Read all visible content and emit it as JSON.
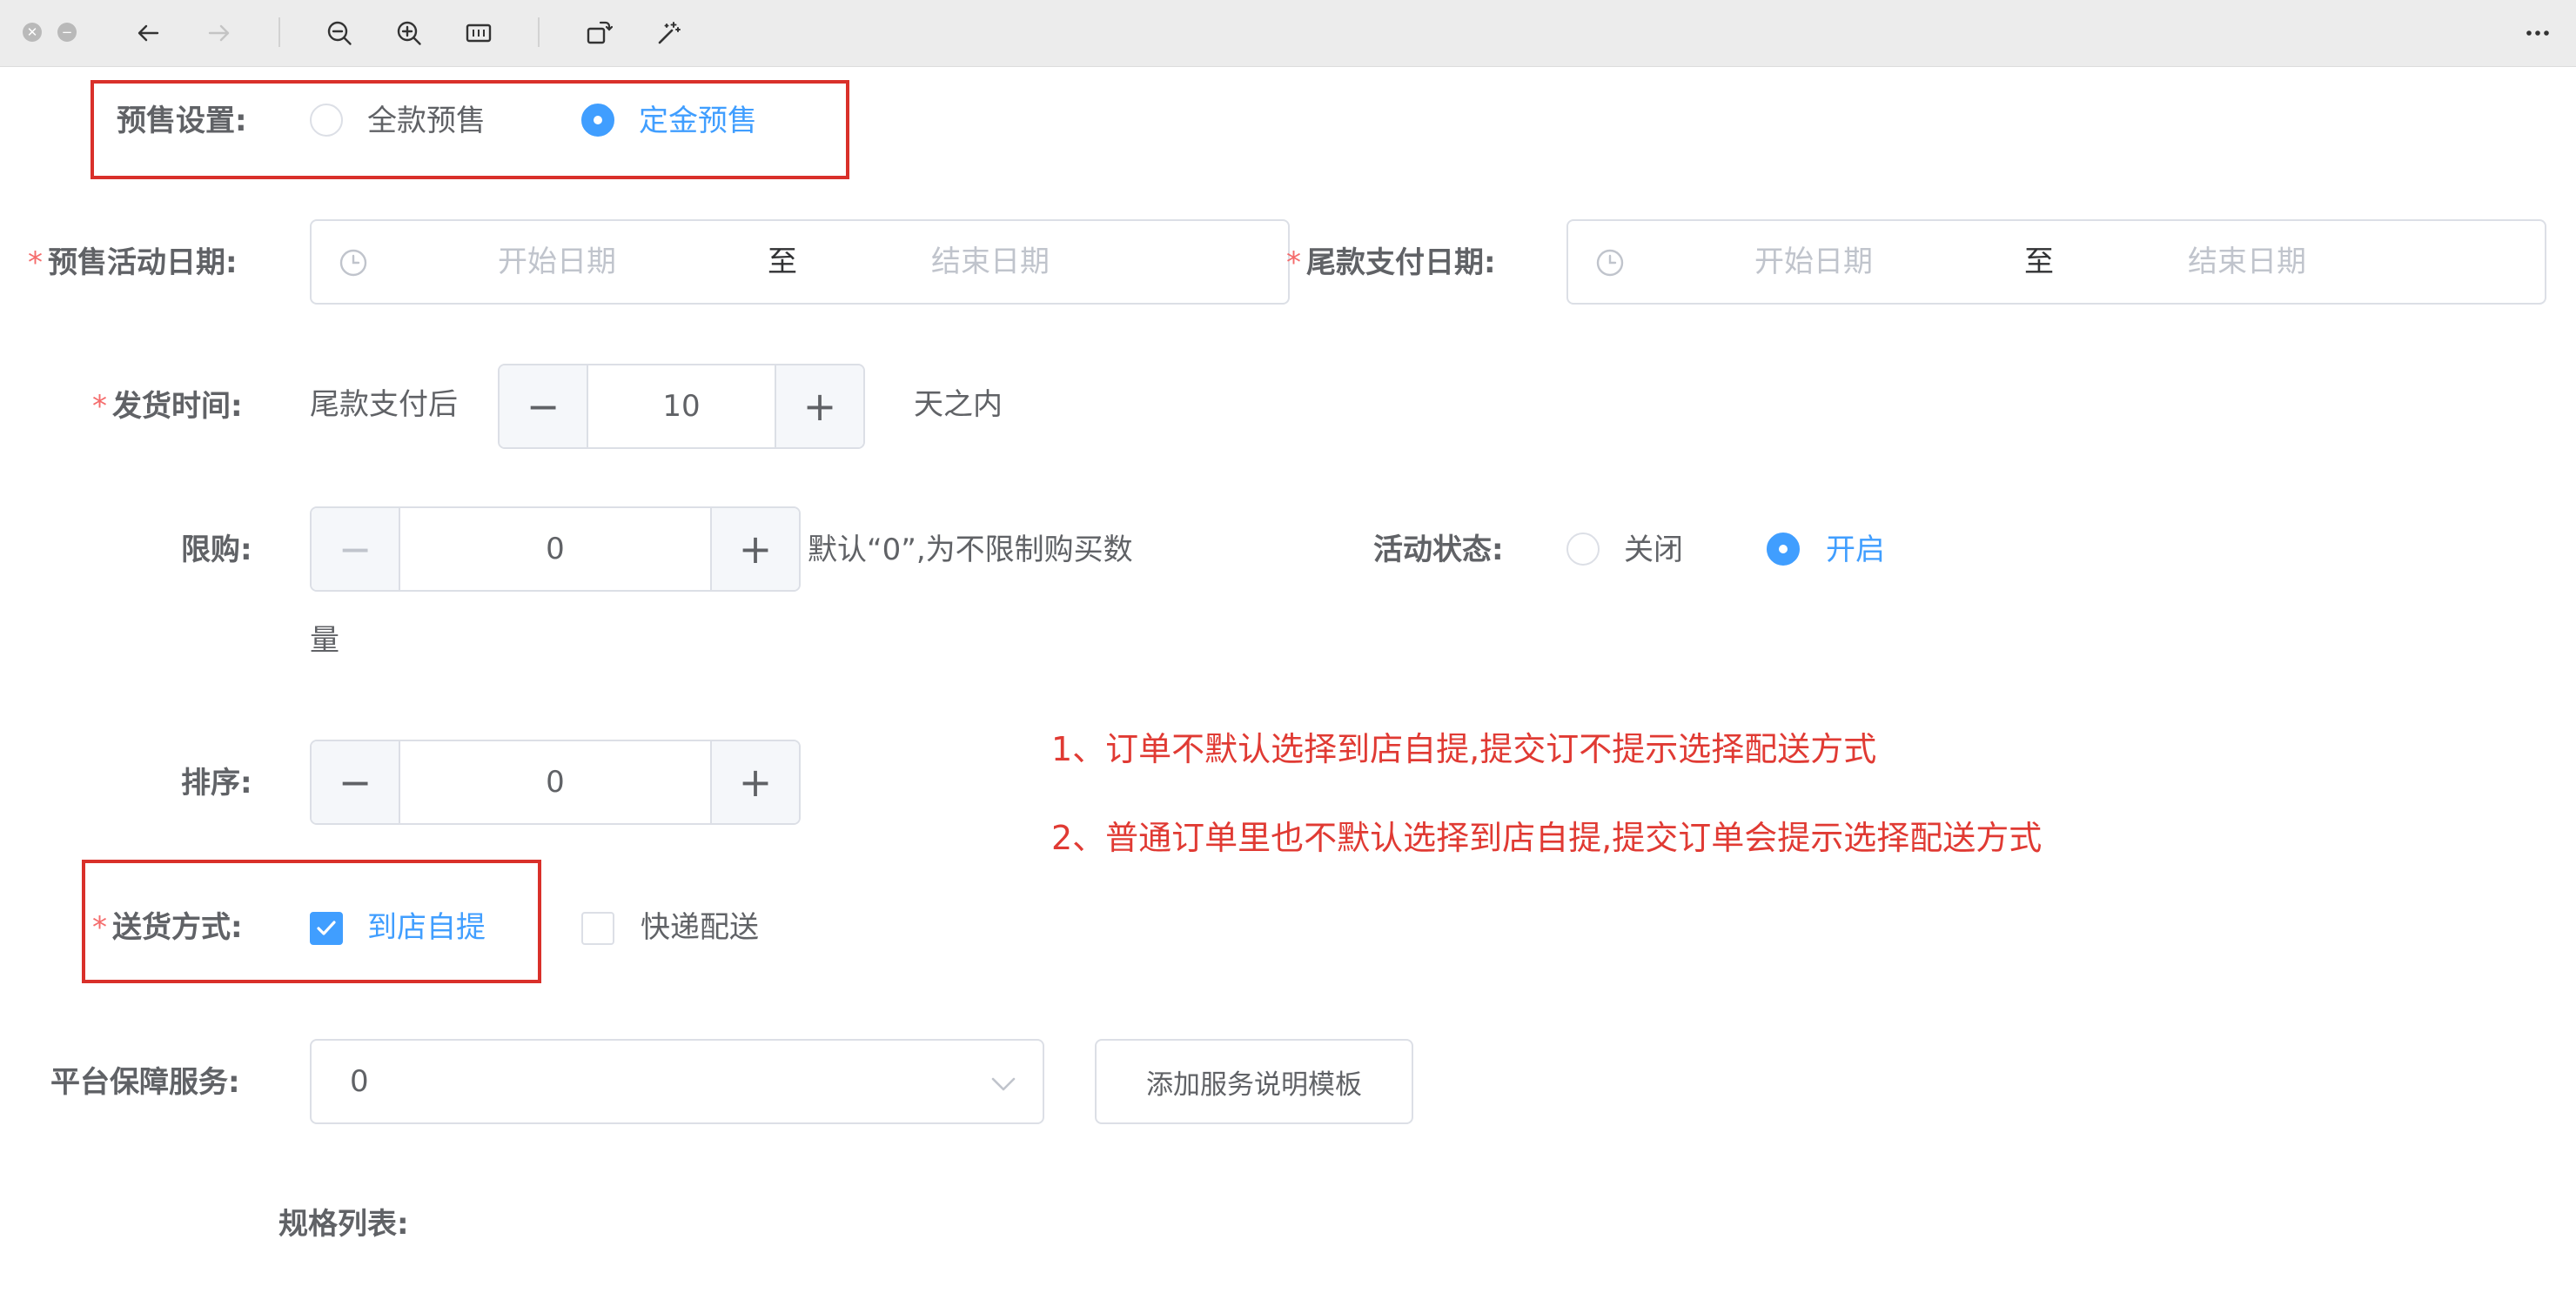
{
  "toolbar": {
    "icons": [
      "close-icon",
      "minimize-icon",
      "back-arrow-icon",
      "forward-arrow-icon",
      "zoom-out-icon",
      "zoom-in-icon",
      "fit-icon",
      "rotate-icon",
      "magic-wand-icon",
      "more-icon"
    ]
  },
  "presale": {
    "label": "预售设置:",
    "option_full": "全款预售",
    "option_deposit": "定金预售",
    "selected": "定金预售"
  },
  "activity_date": {
    "required": "*",
    "label": "预售活动日期:",
    "start_placeholder": "开始日期",
    "separator": "至",
    "end_placeholder": "结束日期"
  },
  "final_payment_date": {
    "required": "*",
    "label": "尾款支付日期:",
    "start_placeholder": "开始日期",
    "separator": "至",
    "end_placeholder": "结束日期"
  },
  "shipping_time": {
    "required": "*",
    "label": "发货时间:",
    "prefix": "尾款支付后",
    "value": "10",
    "suffix": "天之内",
    "minus": "−",
    "plus": "+"
  },
  "purchase_limit": {
    "label": "限购:",
    "value": "0",
    "hint_line1": "默认“0”,为不限制购买数",
    "hint_line2": "量",
    "minus": "−",
    "plus": "+"
  },
  "activity_status": {
    "label": "活动状态:",
    "option_off": "关闭",
    "option_on": "开启",
    "selected": "开启"
  },
  "sort": {
    "label": "排序:",
    "value": "0",
    "minus": "−",
    "plus": "+"
  },
  "notes": {
    "line1": "1、订单不默认选择到店自提,提交订不提示选择配送方式",
    "line2": "2、普通订单里也不默认选择到店自提,提交订单会提示选择配送方式"
  },
  "delivery": {
    "required": "*",
    "label": "送货方式:",
    "option_pickup": "到店自提",
    "option_express": "快递配送",
    "pickup_checked": true,
    "express_checked": false
  },
  "platform_service": {
    "label": "平台保障服务:",
    "value": "0",
    "add_template_button": "添加服务说明模板"
  },
  "spec_list": {
    "label": "规格列表:"
  },
  "colors": {
    "primary": "#409eff",
    "required": "#f56c6c",
    "annotation": "#e03a33",
    "border": "#dcdfe6"
  }
}
